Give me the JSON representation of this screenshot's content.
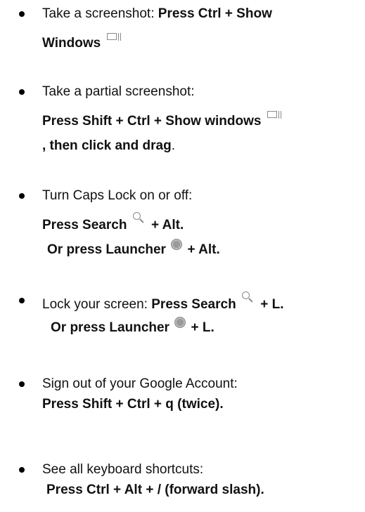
{
  "items": [
    {
      "intro": "Take a screenshot: ",
      "cmd_1": "Press Ctrl + Show",
      "cmd_2": "Windows"
    },
    {
      "intro": "Take a partial screenshot:",
      "cmd_1": "Press Shift + Ctrl + Show windows",
      "cmd_2": ", then click and drag",
      "end": "."
    },
    {
      "intro": "Turn Caps Lock on or off:",
      "cmd_1a": "Press Search",
      "cmd_1b": " + Alt.",
      "cmd_2a": "Or press Launcher",
      "cmd_2b": " + Alt."
    },
    {
      "intro": "Lock your screen: ",
      "cmd_1a": "Press Search",
      "cmd_1b": " + L.",
      "cmd_2a": "Or press Launcher",
      "cmd_2b": " + L."
    },
    {
      "intro": "Sign out of your Google Account:",
      "cmd": "Press Shift + Ctrl + q (twice)."
    },
    {
      "intro": "See all keyboard shortcuts:",
      "cmd": "Press Ctrl + Alt + / (forward slash)."
    }
  ],
  "icons": {
    "show_windows": "show-windows-icon",
    "search": "search-icon",
    "launcher": "launcher-icon"
  }
}
